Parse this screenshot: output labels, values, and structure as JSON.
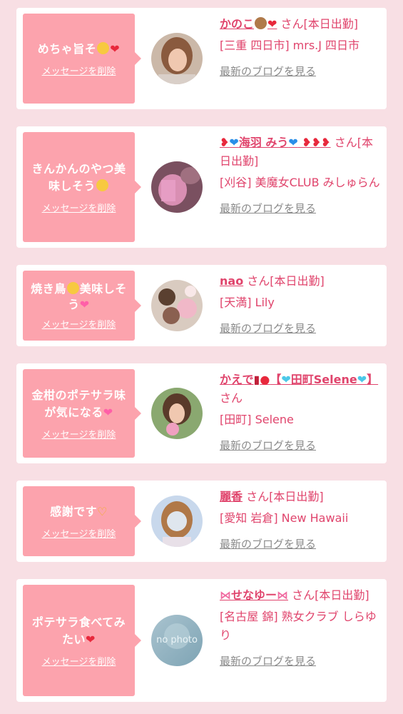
{
  "common": {
    "delete_label": "メッセージを削除",
    "blog_label": "最新のブログを見る",
    "san": "さん",
    "no_photo": "no photo"
  },
  "cards": [
    {
      "message_a": "めちゃ旨そ",
      "message_b": "",
      "name_a": "かのこ",
      "name_b": "",
      "suffix": "[本日出勤]",
      "shop": "[三重 四日市] mrs.J 四日市"
    },
    {
      "message_a": "きんかんのやつ美味しそう",
      "message_b": "",
      "name_a": "",
      "name_b": "海羽 みう",
      "suffix": "[本日出勤]",
      "shop": "[刈谷] 美魔女CLUB みしゅらん"
    },
    {
      "message_a": "焼き鳥",
      "message_b": "美味しそう",
      "name_a": "nao",
      "name_b": "",
      "suffix": "[本日出勤]",
      "shop": "[天満] Lily"
    },
    {
      "message_a": "金柑のポテサラ味が気になる",
      "message_b": "",
      "name_a": "かえで",
      "name_b": "【",
      "name_c": "田町Selene",
      "name_d": "】",
      "suffix": "",
      "shop": "[田町] Selene"
    },
    {
      "message_a": "感謝です",
      "message_b": "",
      "name_a": "麗香",
      "name_b": "",
      "suffix": "[本日出勤]",
      "shop": "[愛知 岩倉] New Hawaii"
    },
    {
      "message_a": "ポテサラ食べてみたい",
      "message_b": "",
      "name_a": "せなゆー",
      "name_b": "",
      "suffix": "[本日出勤]",
      "shop": "[名古屋 錦] 熟女クラブ しらゆり"
    }
  ],
  "icons": {
    "heart": "red-heart-icon",
    "blue_heart": "blue-heart-icon",
    "smile": "smiling-face-icon",
    "love_face": "smiling-face-with-hearts-icon",
    "sparkle_heart": "sparkling-heart-icon",
    "hands": "heart-hands-icon",
    "lipstick": "lipstick-icon",
    "kiss": "kiss-mark-icon",
    "monkey": "monkey-face-icon",
    "ribbon": "pink-ribbon-icon"
  },
  "colors": {
    "accent": "#e0446c",
    "bubble": "#fca3ad",
    "background": "#f8dfe4",
    "muted_link": "#8a8a8a"
  }
}
